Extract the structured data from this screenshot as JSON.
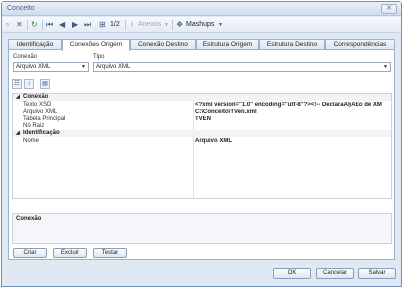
{
  "window": {
    "title": "Conceito",
    "close_glyph": "✕"
  },
  "toolbar": {
    "page_indicator": "1/2",
    "anexos_label": "Anexos",
    "mashups_label": "Mashups"
  },
  "tabs": [
    {
      "label": "Identificação",
      "active": false
    },
    {
      "label": "Conexões Origem",
      "active": true
    },
    {
      "label": "Conexão Destino",
      "active": false
    },
    {
      "label": "Estrutura Origem",
      "active": false
    },
    {
      "label": "Estrutura Destino",
      "active": false
    },
    {
      "label": "Correspondências",
      "active": false
    }
  ],
  "form": {
    "conexao_label": "Conexão",
    "conexao_value": "Arquivo XML",
    "tipo_label": "Tipo",
    "tipo_value": "Arquivo XML"
  },
  "property_grid": {
    "categories": [
      {
        "name": "Conexão",
        "rows": [
          {
            "name": "Texto XSD",
            "value": "<?xml version=\"1.0\" encoding=\"utf-8\"?><!-- DeclaraÃ§Ã£o de XM"
          },
          {
            "name": "Arquivo XML",
            "value": "C:\\Conceito\\TVen.xml"
          },
          {
            "name": "Tabela Principal",
            "value": "TVEN"
          },
          {
            "name": "Nó Raiz",
            "value": ""
          }
        ]
      },
      {
        "name": "Identificação",
        "rows": [
          {
            "name": "Nome",
            "value": "Arquivo XML"
          }
        ]
      }
    ]
  },
  "description": {
    "title": "Conexão"
  },
  "buttons": {
    "criar": "Criar",
    "excluir": "Excluir",
    "testar": "Testar",
    "ok": "OK",
    "cancelar": "Cancelar",
    "salvar": "Salvar"
  }
}
